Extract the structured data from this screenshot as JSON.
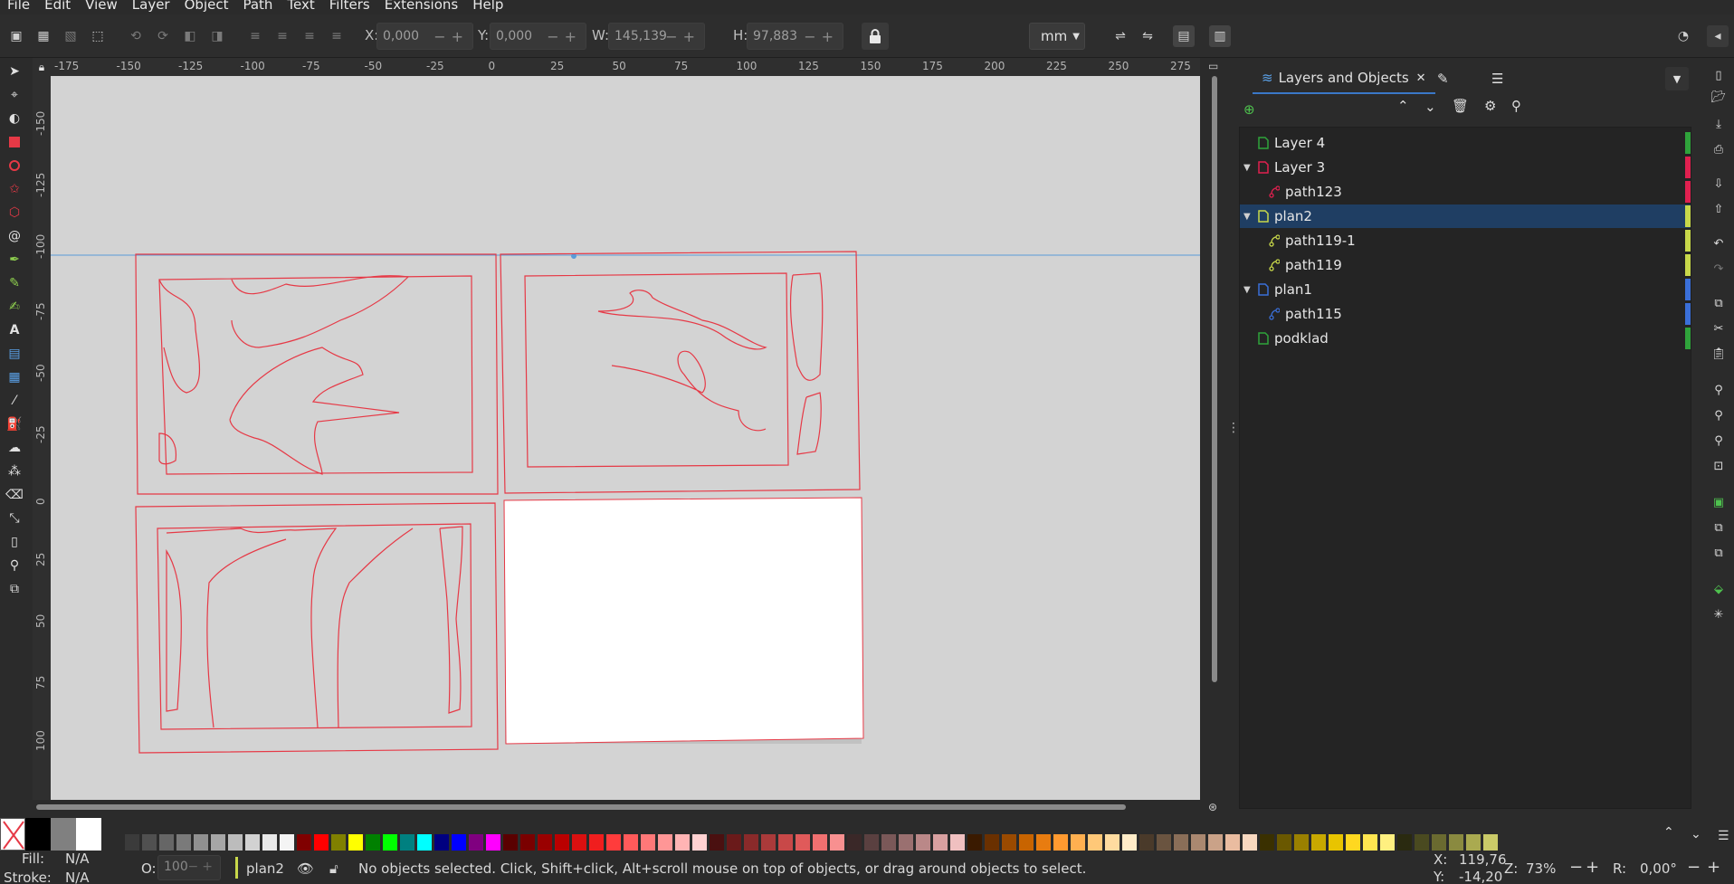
{
  "menu": [
    "File",
    "Edit",
    "View",
    "Layer",
    "Object",
    "Path",
    "Text",
    "Filters",
    "Extensions",
    "Help"
  ],
  "toolbar": {
    "x_label": "X:",
    "x_value": "0,000",
    "y_label": "Y:",
    "y_value": "0,000",
    "w_label": "W:",
    "w_value": "145,139",
    "h_label": "H:",
    "h_value": "97,883",
    "unit": "mm"
  },
  "rulers": {
    "top": [
      "-175",
      "-150",
      "-125",
      "-100",
      "-75",
      "-50",
      "-25",
      "0",
      "25",
      "50",
      "75",
      "100",
      "125",
      "150",
      "175",
      "200",
      "225",
      "250",
      "275"
    ],
    "left": [
      "-150",
      "-125",
      "-100",
      "-75",
      "-50",
      "-25",
      "0",
      "25",
      "50",
      "75",
      "100"
    ]
  },
  "dock": {
    "tab_label": "Layers and Objects",
    "layers": [
      {
        "label": "Layer 4",
        "depth": 0,
        "expanded": null,
        "color": "#2fa33b",
        "selected": false
      },
      {
        "label": "Layer 3",
        "depth": 0,
        "expanded": true,
        "color": "#e0204f",
        "selected": false
      },
      {
        "label": "path123",
        "depth": 1,
        "expanded": null,
        "color": "#e0204f",
        "selected": false
      },
      {
        "label": "plan2",
        "depth": 0,
        "expanded": true,
        "color": "#c8d84a",
        "selected": true
      },
      {
        "label": "path119-1",
        "depth": 1,
        "expanded": null,
        "color": "#c8d84a",
        "selected": false
      },
      {
        "label": "path119",
        "depth": 1,
        "expanded": null,
        "color": "#c8d84a",
        "selected": false
      },
      {
        "label": "plan1",
        "depth": 0,
        "expanded": true,
        "color": "#3a6fd8",
        "selected": false
      },
      {
        "label": "path115",
        "depth": 1,
        "expanded": null,
        "color": "#3a6fd8",
        "selected": false
      },
      {
        "label": "podklad",
        "depth": 0,
        "expanded": null,
        "color": "#2fa33b",
        "selected": false
      }
    ]
  },
  "status": {
    "fill_label": "Fill:",
    "fill_value": "N/A",
    "stroke_label": "Stroke:",
    "stroke_value": "N/A",
    "opacity_label": "O:",
    "opacity_value": "100",
    "layer_name": "plan2",
    "message": "No objects selected. Click, Shift+click, Alt+scroll mouse on top of objects, or drag around objects to select.",
    "x_label": "X:",
    "x_value": "119,76",
    "y_label": "Y:",
    "y_value": "-14,20",
    "zoom_label": "Z:",
    "zoom_value": "73%",
    "rotate_label": "R:",
    "rotate_value": "0,00°"
  },
  "palette": [
    "#ffffff",
    "#000000",
    "#808080",
    "#ffffff",
    "#3b3b3b",
    "#505050",
    "#666666",
    "#7a7a7a",
    "#909090",
    "#a6a6a6",
    "#bcbcbc",
    "#d2d2d2",
    "#e8e8e8",
    "#f4f4f4",
    "#800000",
    "#ff0000",
    "#808000",
    "#ffff00",
    "#008000",
    "#00ff00",
    "#008080",
    "#00ffff",
    "#000080",
    "#0000ff",
    "#800080",
    "#ff00ff",
    "#5a0000",
    "#7a0000",
    "#9a0000",
    "#ba0000",
    "#da1010",
    "#f01e1e",
    "#ff3c3c",
    "#ff5a5a",
    "#ff7878",
    "#ff9696",
    "#ffb4b4",
    "#ffd2d2",
    "#4a1010",
    "#6a1a1a",
    "#8a2a2a",
    "#aa3a3a",
    "#c84848",
    "#e05a5a",
    "#f07070",
    "#f89090",
    "#3a2828",
    "#5a4040",
    "#7a5858",
    "#9a7070",
    "#ba8888",
    "#d8a0a0",
    "#f0c0c0",
    "#3a1a00",
    "#6a3000",
    "#9a4a00",
    "#c86400",
    "#e87c10",
    "#ff9a30",
    "#ffb050",
    "#ffc878",
    "#ffdca0",
    "#ffecc8",
    "#4a3a2a",
    "#6a5440",
    "#8a6e58",
    "#aa8870",
    "#caa288",
    "#eabca0",
    "#f8d8c0",
    "#3a3000",
    "#6a5800",
    "#9a8000",
    "#c8a800",
    "#e8c400",
    "#ffd820",
    "#ffe650",
    "#fff080",
    "#2a2a10",
    "#4a4a20",
    "#6a6a30",
    "#8a8a40",
    "#aaaa50",
    "#caca68"
  ]
}
